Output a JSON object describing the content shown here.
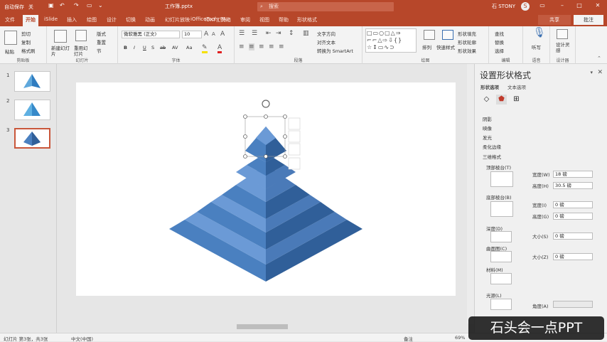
{
  "titlebar": {
    "autosave": "自动保存",
    "toggle": "关",
    "filename": "工作簿.pptx",
    "search_placeholder": "搜索",
    "user": "石 STONY",
    "avatar_initial": "S"
  },
  "tabs": [
    "文件",
    "开始",
    "iSlide",
    "插入",
    "绘图",
    "设计",
    "切换",
    "动画",
    "幻灯片放映",
    "iOfficeTools PA",
    "iOKT工具箱",
    "审阅",
    "视图",
    "帮助",
    "形状格式"
  ],
  "active_tab": "开始",
  "share_label": "共享",
  "comment_label": "批注",
  "ribbon": {
    "clipboard": {
      "paste": "粘贴",
      "cut": "剪切",
      "copy": "复制",
      "painter": "格式刷",
      "label": "剪贴板"
    },
    "slides": {
      "new": "新建幻灯片",
      "reuse": "重用幻灯片",
      "layout": "版式",
      "reset": "重置",
      "section": "节",
      "label": "幻灯片"
    },
    "font": {
      "name": "微软雅黑 (正文)",
      "size": "10",
      "label": "字体",
      "buttons": [
        "B",
        "I",
        "U",
        "S",
        "ab",
        "AV",
        "Aa"
      ]
    },
    "paragraph": {
      "textdir": "文字方向",
      "align": "对齐文本",
      "smartart": "转换为 SmartArt",
      "label": "段落"
    },
    "drawing": {
      "arrange": "排列",
      "quickstyles": "快速样式",
      "fill": "形状填充",
      "outline": "形状轮廓",
      "effects": "形状效果",
      "label": "绘图"
    },
    "editing": {
      "find": "查找",
      "replace": "替换",
      "select": "选择",
      "label": "编辑"
    },
    "voice": {
      "dictate": "听写",
      "label": "语音"
    },
    "designer": {
      "ideas": "设计灵感",
      "label": "设计器"
    }
  },
  "slides": [
    {
      "number": "1",
      "selected": false
    },
    {
      "number": "2",
      "selected": false
    },
    {
      "number": "3",
      "selected": true
    }
  ],
  "pane": {
    "title": "设置形状格式",
    "tabs": [
      "形状选项",
      "文本选项"
    ],
    "sections": [
      "阴影",
      "映像",
      "发光",
      "柔化边缘",
      "三维格式"
    ],
    "top_bevel_label": "顶部棱台(T)",
    "bottom_bevel_label": "底部棱台(B)",
    "top_width_label": "宽度(W)",
    "top_width_value": "18 磅",
    "top_height_label": "高度(H)",
    "top_height_value": "30.5 磅",
    "bottom_width_label": "宽度(I)",
    "bottom_width_value": "0 磅",
    "bottom_height_label": "高度(G)",
    "bottom_height_value": "0 磅",
    "depth_label": "深度(D)",
    "depth_size_label": "大小(S)",
    "depth_size_value": "0 磅",
    "contour_label": "曲面图(C)",
    "contour_size_label": "大小(Z)",
    "contour_size_value": "0 磅",
    "material_label": "材料(M)",
    "lighting_label": "光源(L)",
    "angle_label": "角度(A)",
    "angle_value": ""
  },
  "status": {
    "slide_info": "幻灯片 第3张，共3张",
    "language": "中文(中国)",
    "notes": "备注",
    "zoom": "69%"
  },
  "watermark": "石头会一点PPT",
  "colors": {
    "accent": "#b7472a",
    "pyramid_front": "#4a80c0",
    "pyramid_right": "#305f99",
    "pyramid_top": "#6b9ad6"
  }
}
